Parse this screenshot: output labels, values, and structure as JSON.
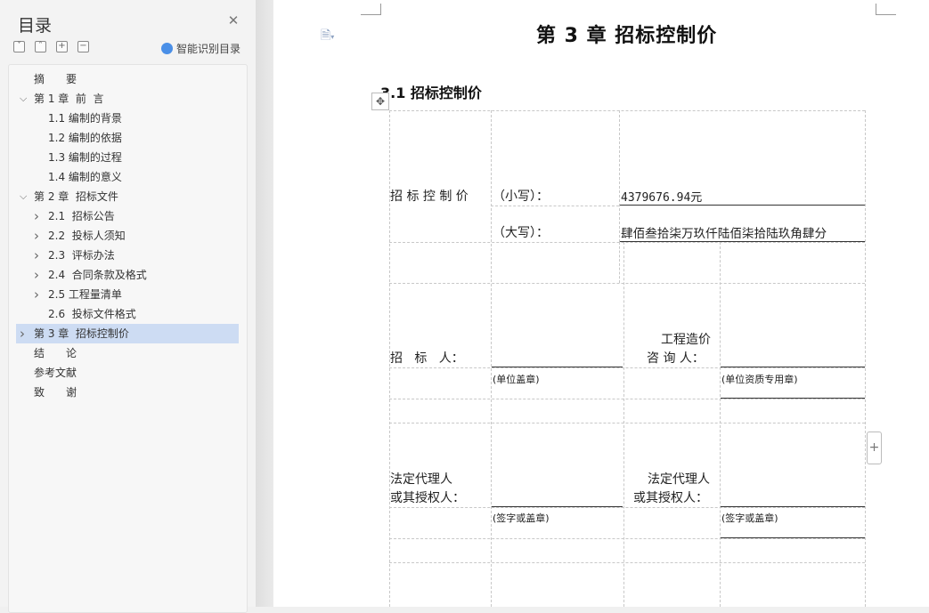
{
  "toc": {
    "title": "目录",
    "smart_label": "智能识别目录",
    "items": [
      {
        "label": "摘　　要",
        "level": 1,
        "chevron": ""
      },
      {
        "label": "第 1 章  前  言",
        "level": 1,
        "chevron": "open"
      },
      {
        "label": "1.1 编制的背景",
        "level": 2,
        "chevron": ""
      },
      {
        "label": "1.2 编制的依据",
        "level": 2,
        "chevron": ""
      },
      {
        "label": "1.3 编制的过程",
        "level": 2,
        "chevron": ""
      },
      {
        "label": "1.4 编制的意义",
        "level": 2,
        "chevron": ""
      },
      {
        "label": "第 2 章  招标文件",
        "level": 1,
        "chevron": "open"
      },
      {
        "label": "2.1  招标公告",
        "level": 2,
        "chevron": "closed"
      },
      {
        "label": "2.2  投标人须知",
        "level": 2,
        "chevron": "closed"
      },
      {
        "label": "2.3  评标办法",
        "level": 2,
        "chevron": "closed"
      },
      {
        "label": "2.4  合同条款及格式",
        "level": 2,
        "chevron": "closed"
      },
      {
        "label": "2.5 工程量清单",
        "level": 2,
        "chevron": "closed"
      },
      {
        "label": "2.6  投标文件格式",
        "level": 2,
        "chevron": ""
      },
      {
        "label": "第 3 章  招标控制价",
        "level": 1,
        "chevron": "closed",
        "selected": true
      },
      {
        "label": "结　　论",
        "level": 1,
        "chevron": ""
      },
      {
        "label": "参考文献",
        "level": 1,
        "chevron": ""
      },
      {
        "label": "致　　谢",
        "level": 1,
        "chevron": ""
      }
    ]
  },
  "document": {
    "chapter_title": "第 3 章  招标控制价",
    "section_title": "3.1 招标控制价",
    "table": {
      "price_label": "招 标 控 制 价",
      "lower_label": "（小写）：",
      "lower_value": "4379676.94元",
      "upper_label": "（大写）：",
      "upper_value": "肆佰叁拾柒万玖仟陆佰柒拾陆玖角肆分",
      "tenderer_label": "招   标   人：",
      "consultant_label_1": "工程造价",
      "consultant_label_2": "咨 询 人：",
      "unit_seal": "(单位盖章)",
      "qual_seal": "(单位资质专用章)",
      "legal_rep_1": "法定代理人",
      "legal_rep_2": "或其授权人：",
      "sign_seal": "(签字或盖章)"
    }
  }
}
